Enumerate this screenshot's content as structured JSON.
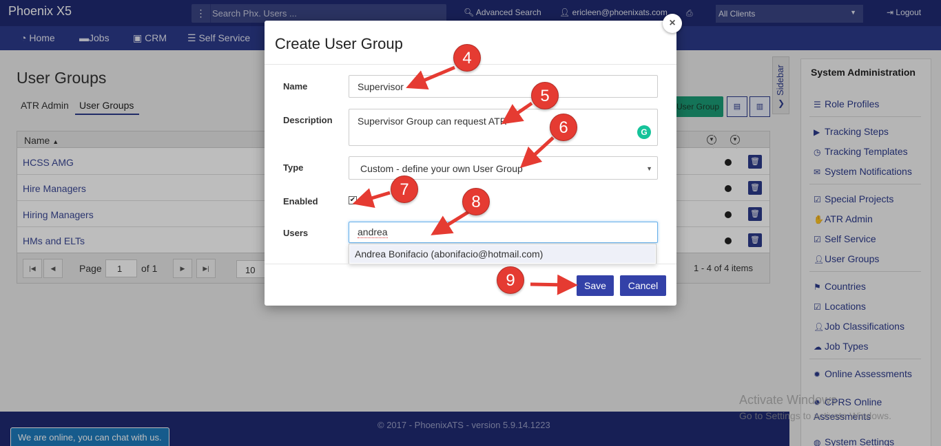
{
  "app": {
    "brand": "Phoenix X5"
  },
  "topbar": {
    "search_placeholder": "Search Phx. Users ...",
    "advanced_search": "Advanced Search",
    "user_email": "ericleen@phoenixats.com",
    "clients": "All Clients",
    "logout": "Logout"
  },
  "nav": {
    "home": "Home",
    "jobs": "Jobs",
    "crm": "CRM",
    "self_service": "Self Service"
  },
  "page": {
    "title": "User Groups",
    "tabs": [
      "ATR Admin",
      "User Groups"
    ],
    "active_tab": "User Groups",
    "add_button": "User Group"
  },
  "grid": {
    "column_name": "Name",
    "sort_indicator": "▲",
    "rows": [
      "HCSS AMG",
      "Hire Managers",
      "Hiring Managers",
      "HMs and ELTs"
    ],
    "pager": {
      "page_label": "Page",
      "page_value": "1",
      "of_label": "of 1",
      "page_size": "10",
      "items_label": "1 - 4 of 4 items"
    }
  },
  "sidebar_tab": "Sidebar",
  "admin_panel": {
    "title": "System Administration",
    "groups": [
      [
        "Role Profiles"
      ],
      [
        "Tracking Steps",
        "Tracking Templates",
        "System Notifications"
      ],
      [
        "Special Projects",
        "ATR Admin",
        "Self Service",
        "User Groups"
      ],
      [
        "Countries",
        "Locations",
        "Job Classifications",
        "Job Types"
      ],
      [
        "Online Assessments",
        "CPRS Online Assessments",
        "System Settings"
      ]
    ]
  },
  "footer": {
    "copyright": "© 2017 - PhoenixATS - version 5.9.14.1223",
    "chat": "We are online, you can chat with us."
  },
  "watermark": {
    "line1": "Activate Windows",
    "line2": "Go to Settings to activate Windows."
  },
  "modal": {
    "title": "Create User Group",
    "close": "×",
    "name_label": "Name",
    "name_value": "Supervisor",
    "description_label": "Description",
    "description_value": "Supervisor Group can request ATR",
    "type_label": "Type",
    "type_value": "Custom - define your own User Group",
    "enabled_label": "Enabled",
    "enabled_checked": true,
    "users_label": "Users",
    "users_value": "andrea",
    "suggestion": "Andrea Bonifacio (abonifacio@hotmail.com)",
    "save": "Save",
    "cancel": "Cancel"
  },
  "steps": [
    "4",
    "5",
    "6",
    "7",
    "8",
    "9"
  ],
  "colors": {
    "topbar": "#1f2a73",
    "navbar": "#2c3a8c",
    "primary_button": "#3341a8",
    "step_marker": "#e53b32",
    "add_button": "#1c9d77"
  }
}
